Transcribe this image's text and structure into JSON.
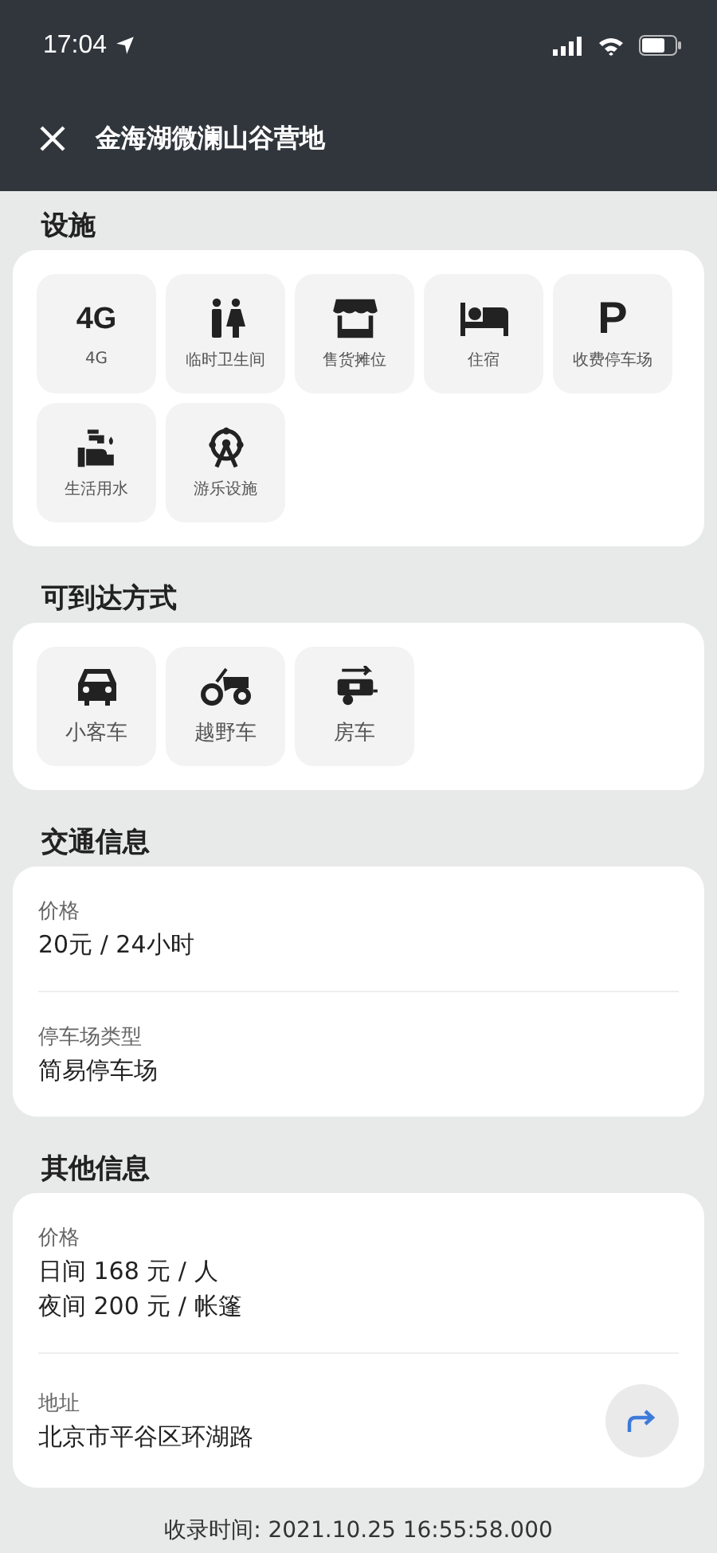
{
  "status_bar": {
    "time": "17:04"
  },
  "nav": {
    "title": "金海湖微澜山谷营地"
  },
  "sections": [
    {
      "title": "设施",
      "kind": "tiles",
      "items": [
        {
          "kind": "glyph",
          "glyph": "4G",
          "label": "4G"
        },
        {
          "kind": "toilet",
          "label": "临时卫生间"
        },
        {
          "kind": "stall",
          "label": "售货摊位"
        },
        {
          "kind": "bed",
          "label": "住宿"
        },
        {
          "kind": "glyph",
          "glyph": "P",
          "label": "收费停车场"
        },
        {
          "kind": "water",
          "label": "生活用水"
        },
        {
          "kind": "ferris",
          "label": "游乐设施"
        }
      ]
    },
    {
      "title": "可到达方式",
      "kind": "vehicles",
      "items": [
        {
          "kind": "car",
          "label": "小客车"
        },
        {
          "kind": "tractor",
          "label": "越野车"
        },
        {
          "kind": "rv",
          "label": "房车"
        }
      ]
    },
    {
      "title": "交通信息",
      "kind": "info",
      "rows": [
        {
          "label": "价格",
          "lines": [
            "20元 / 24小时"
          ]
        },
        {
          "label": "停车场类型",
          "lines": [
            "简易停车场"
          ]
        }
      ]
    },
    {
      "title": "其他信息",
      "kind": "info",
      "rows": [
        {
          "label": "价格",
          "lines": [
            "日间 168 元 / 人",
            "夜间 200 元 / 帐篷"
          ]
        },
        {
          "label": "地址",
          "lines": [
            "北京市平谷区环湖路"
          ],
          "navigate": true
        }
      ]
    }
  ],
  "footer": "收录时间: 2021.10.25 16:55:58.000"
}
